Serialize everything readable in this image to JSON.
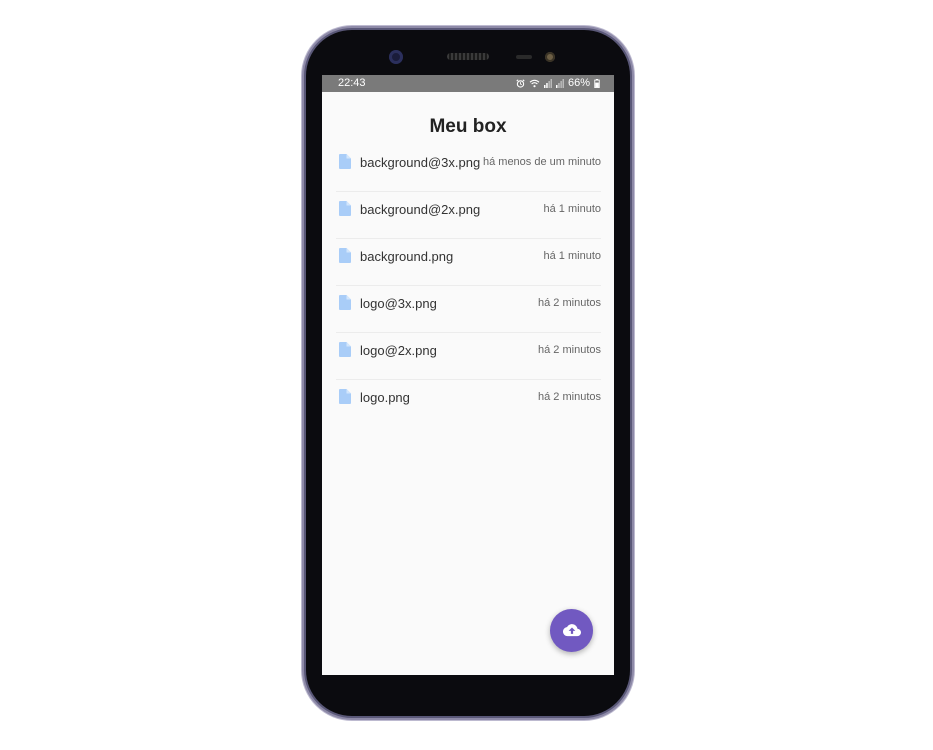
{
  "status_bar": {
    "time": "22:43",
    "battery_text": "66%",
    "icons": [
      "alarm-icon",
      "wifi-icon",
      "signal-icon",
      "signal-icon",
      "battery-icon"
    ]
  },
  "header": {
    "title": "Meu box"
  },
  "files": [
    {
      "name": "background@3x.png",
      "time": "há menos de um minuto",
      "icon": "file-icon"
    },
    {
      "name": "background@2x.png",
      "time": "há 1 minuto",
      "icon": "file-icon"
    },
    {
      "name": "background.png",
      "time": "há 1 minuto",
      "icon": "file-icon"
    },
    {
      "name": "logo@3x.png",
      "time": "há 2 minutos",
      "icon": "file-icon"
    },
    {
      "name": "logo@2x.png",
      "time": "há 2 minutos",
      "icon": "file-icon"
    },
    {
      "name": "logo.png",
      "time": "há 2 minutos",
      "icon": "file-icon"
    }
  ],
  "fab": {
    "icon": "cloud-upload-icon"
  },
  "colors": {
    "accent": "#7159c1",
    "file_icon": "#a9cdf8",
    "screen_bg": "#fafafa",
    "status_bar_bg": "#7a7a7a"
  }
}
